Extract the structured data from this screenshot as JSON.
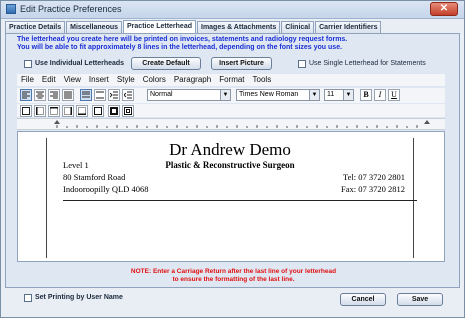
{
  "window": {
    "title": "Edit Practice Preferences",
    "close_label": "✕"
  },
  "tabs": [
    {
      "label": "Practice Details"
    },
    {
      "label": "Miscellaneous"
    },
    {
      "label": "Practice Letterhead"
    },
    {
      "label": "Images & Attachments"
    },
    {
      "label": "Clinical"
    },
    {
      "label": "Carrier Identifiers"
    }
  ],
  "info": {
    "line1": "The letterhead you create here will be printed on invoices, statements and radiology request forms.",
    "line2": "You will be able to fit approximately 8 lines in the letterhead, depending on the font sizes you use."
  },
  "options": {
    "individual_letterheads": "Use Individual Letterheads",
    "create_default": "Create Default",
    "insert_picture": "Insert Picture",
    "single_letterhead_statements": "Use Single Letterhead for Statements"
  },
  "menu": [
    "File",
    "Edit",
    "View",
    "Insert",
    "Style",
    "Colors",
    "Paragraph",
    "Format",
    "Tools"
  ],
  "format": {
    "style": "Normal",
    "font": "Times New Roman",
    "size": "11",
    "bold": "B",
    "italic": "I",
    "underline": "U"
  },
  "letterhead": {
    "name": "Dr Andrew Demo",
    "specialty": "Plastic & Reconstructive Surgeon",
    "address1": "Level 1",
    "address2": "80 Stamford Road",
    "address3": "Indooroopilly QLD 4068",
    "tel": "Tel: 07 3720 2801",
    "fax": "Fax: 07 3720 2812"
  },
  "note": {
    "line1": "NOTE: Enter a Carriage Return after the last line of your letterhead",
    "line2": "to ensure the formatting of the last line."
  },
  "footer": {
    "set_printing_by_user": "Set Printing by User Name",
    "cancel": "Cancel",
    "save": "Save"
  }
}
